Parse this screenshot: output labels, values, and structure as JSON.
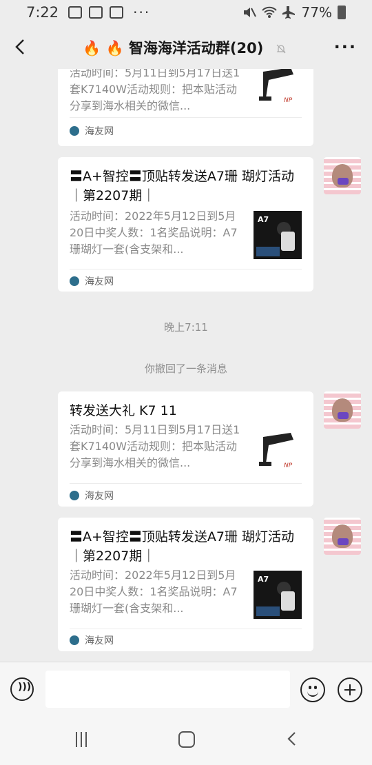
{
  "status": {
    "time": "7:22",
    "dots": "···",
    "battery": "77%"
  },
  "header": {
    "fire1": "🔥",
    "fire2": "🔥",
    "title": "智海海洋活动群(20)",
    "more": "···"
  },
  "chat": {
    "cards": [
      {
        "title": "",
        "desc": "活动时间：5月11日到5月17日送1套K7140W活动规则：把本贴活动分享到海水相关的微信...",
        "source": "海友网"
      },
      {
        "title": "〓A+智控〓顶贴转发送A7珊 瑚灯活动｜第2207期｜",
        "desc": "活动时间：2022年5月12日到5月20日中奖人数：1名奖品说明：A7珊瑚灯一套(含支架和...",
        "source": "海友网",
        "thumb_label": "A7"
      },
      {
        "title": "转发送大礼 K7 11",
        "desc": "活动时间：5月11日到5月17日送1套K7140W活动规则：把本贴活动分享到海水相关的微信...",
        "source": "海友网"
      },
      {
        "title": "〓A+智控〓顶贴转发送A7珊 瑚灯活动｜第2207期｜",
        "desc": "活动时间：2022年5月12日到5月20日中奖人数：1名奖品说明：A7珊瑚灯一套(含支架和...",
        "source": "海友网",
        "thumb_label": "A7"
      }
    ],
    "timestamp": "晚上7:11",
    "recall_notice": "你撤回了一条消息"
  },
  "colors": {
    "background": "#ededed",
    "card": "#ffffff",
    "muted_text": "#8a8a8a"
  }
}
